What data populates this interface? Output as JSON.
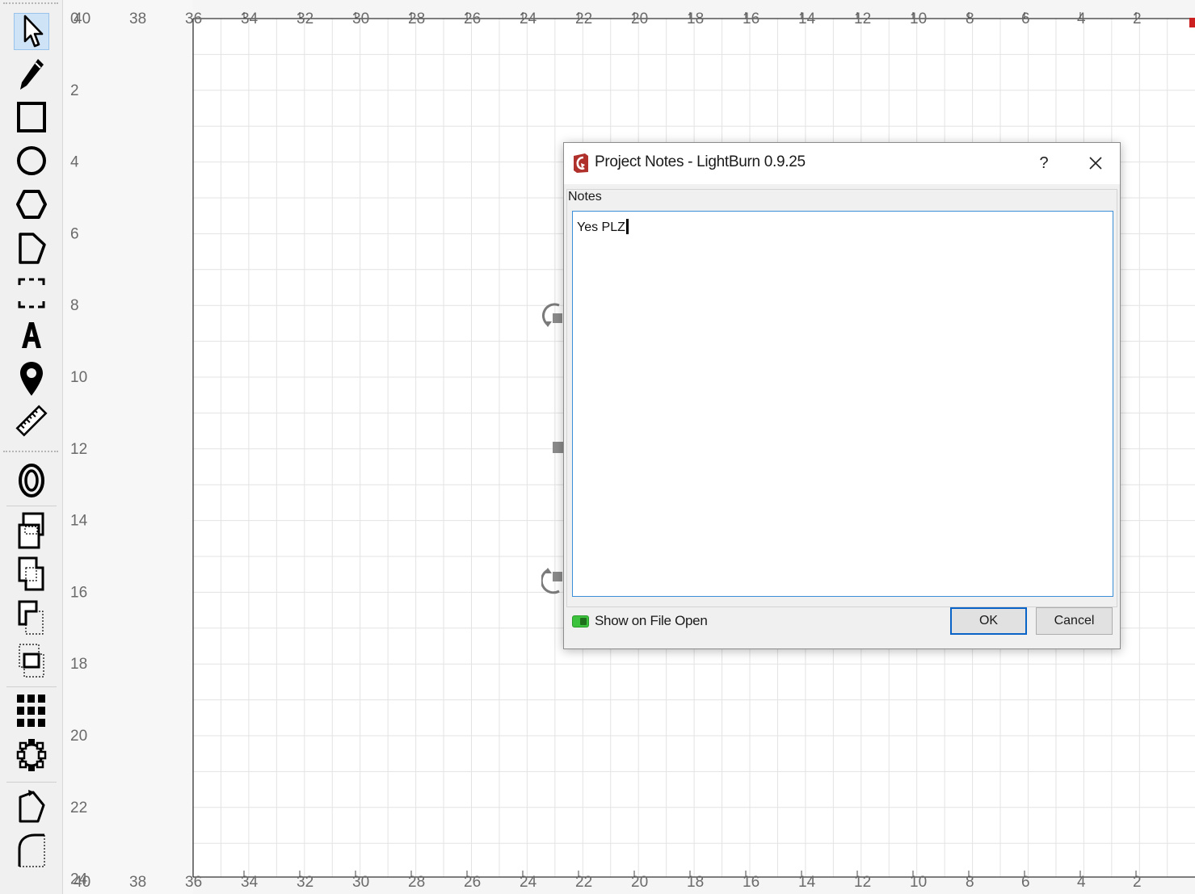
{
  "toolbar": {
    "tools": [
      {
        "name": "select",
        "icon": "cursor-arrow-icon",
        "active": true
      },
      {
        "name": "edit-nodes",
        "icon": "pencil-icon"
      },
      {
        "name": "rectangle",
        "icon": "rectangle-icon"
      },
      {
        "name": "ellipse",
        "icon": "circle-icon"
      },
      {
        "name": "polygon",
        "icon": "hexagon-icon"
      },
      {
        "name": "lines",
        "icon": "pen-polygon-icon"
      },
      {
        "name": "position-laser",
        "icon": "dashed-rectangle-icon"
      },
      {
        "name": "text",
        "icon": "text-a-icon"
      },
      {
        "name": "origin",
        "icon": "map-pin-icon"
      },
      {
        "name": "measure",
        "icon": "ruler-icon"
      },
      {
        "name": "offset",
        "icon": "offset-rings-icon"
      },
      {
        "name": "weld",
        "icon": "weld-icon"
      },
      {
        "name": "boolean-union",
        "icon": "boolean-union-icon"
      },
      {
        "name": "boolean-subtract",
        "icon": "boolean-subtract-icon"
      },
      {
        "name": "boolean-intersect",
        "icon": "boolean-intersect-icon"
      },
      {
        "name": "grid-array",
        "icon": "grid-array-icon"
      },
      {
        "name": "circular-array",
        "icon": "circular-array-icon"
      },
      {
        "name": "rotate",
        "icon": "rotate-shape-icon"
      },
      {
        "name": "corner",
        "icon": "rounded-corner-icon"
      }
    ]
  },
  "rulers": {
    "top_labels": [
      "40",
      "38",
      "36",
      "34",
      "32",
      "30",
      "28",
      "26",
      "24",
      "22",
      "20",
      "18",
      "16",
      "14",
      "12",
      "10",
      "8",
      "6",
      "4",
      "2"
    ],
    "left_labels": [
      "0",
      "2",
      "4",
      "6",
      "8",
      "10",
      "12",
      "14",
      "16",
      "18",
      "20",
      "22",
      "24"
    ],
    "bottom_labels": [
      "40",
      "38",
      "36",
      "34",
      "32",
      "30",
      "28",
      "26",
      "24",
      "22",
      "20",
      "18",
      "16",
      "14",
      "12",
      "10",
      "8",
      "6",
      "4",
      "2"
    ],
    "corner_top": "0",
    "corner_bottom": "24"
  },
  "dialog": {
    "title": "Project Notes - LightBurn 0.9.25",
    "help_label": "?",
    "group_label": "Notes",
    "notes_text": "Yes PLZ",
    "show_on_open_label": "Show on File Open",
    "show_on_open_checked": true,
    "ok_label": "OK",
    "cancel_label": "Cancel"
  },
  "colors": {
    "accent": "#0a64c8",
    "toggle_on": "#3cc23c",
    "grid": "#e3e3e3",
    "app_icon": "#b0302c"
  }
}
